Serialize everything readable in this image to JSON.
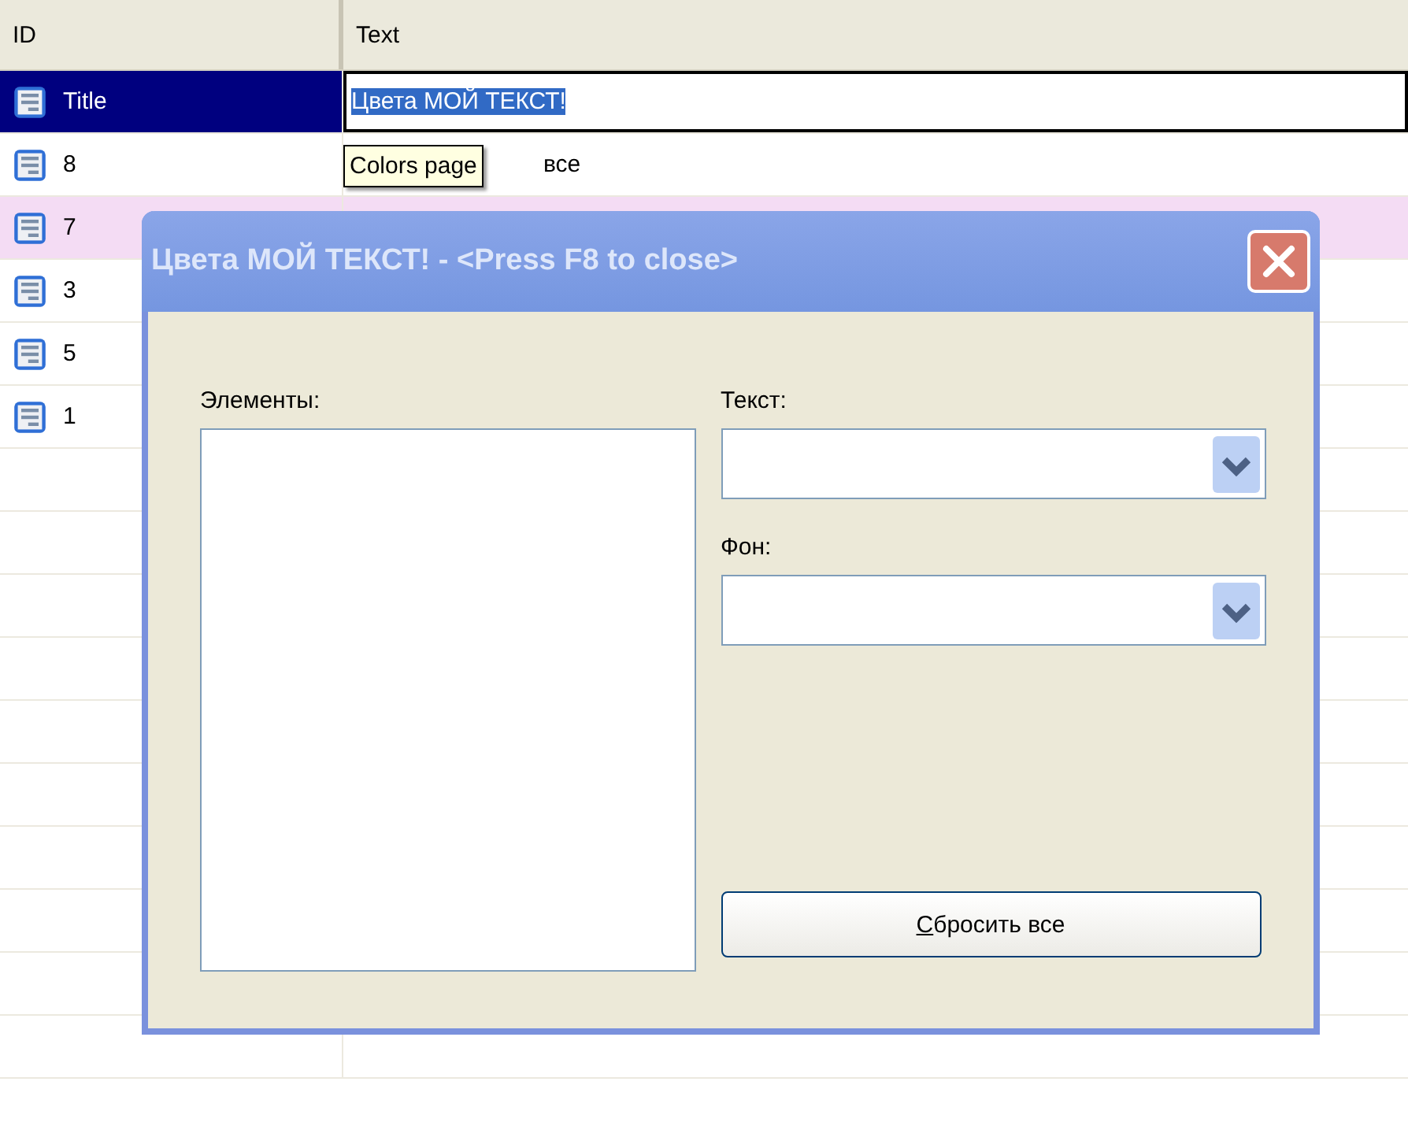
{
  "grid": {
    "columns": [
      "ID",
      "Text"
    ],
    "rows": [
      {
        "id": "Title",
        "text": "Цвета МОЙ ТЕКСТ!",
        "selected": true,
        "editing": true,
        "highlighted": false
      },
      {
        "id": "8",
        "text": "все",
        "selected": false,
        "editing": false,
        "highlighted": false
      },
      {
        "id": "7",
        "selected": false,
        "editing": false,
        "highlighted": true
      },
      {
        "id": "3",
        "selected": false,
        "editing": false,
        "highlighted": false
      },
      {
        "id": "5",
        "selected": false,
        "editing": false,
        "highlighted": false
      },
      {
        "id": "1",
        "selected": false,
        "editing": false,
        "highlighted": false
      }
    ]
  },
  "tooltip": "Colors page",
  "dialog": {
    "title": "Цвета МОЙ ТЕКСТ! - <Press F8 to close>",
    "elements_label": "Элементы:",
    "text_label": "Текст:",
    "background_label": "Фон:",
    "reset_button": "Сбросить все"
  }
}
